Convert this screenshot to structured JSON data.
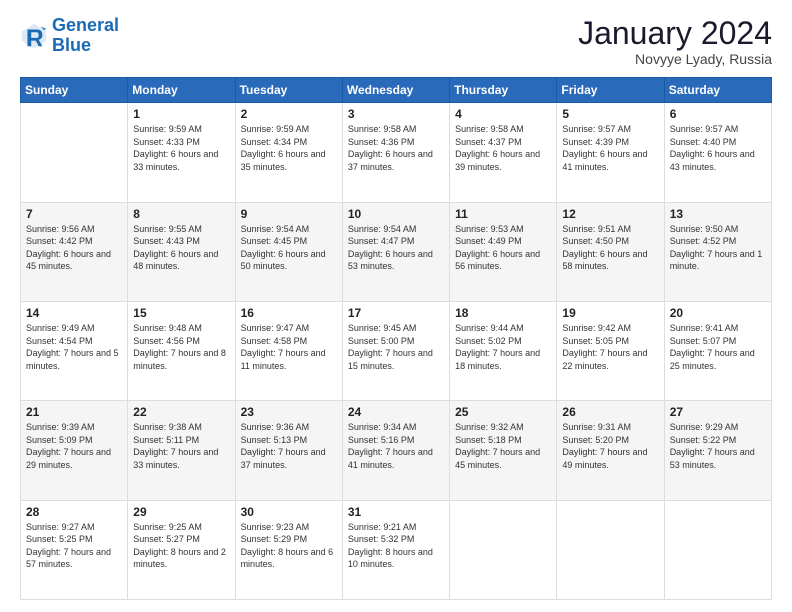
{
  "logo": {
    "line1": "General",
    "line2": "Blue"
  },
  "title": "January 2024",
  "subtitle": "Novyye Lyady, Russia",
  "weekdays": [
    "Sunday",
    "Monday",
    "Tuesday",
    "Wednesday",
    "Thursday",
    "Friday",
    "Saturday"
  ],
  "weeks": [
    [
      {
        "day": "",
        "sunrise": "",
        "sunset": "",
        "daylight": ""
      },
      {
        "day": "1",
        "sunrise": "Sunrise: 9:59 AM",
        "sunset": "Sunset: 4:33 PM",
        "daylight": "Daylight: 6 hours and 33 minutes."
      },
      {
        "day": "2",
        "sunrise": "Sunrise: 9:59 AM",
        "sunset": "Sunset: 4:34 PM",
        "daylight": "Daylight: 6 hours and 35 minutes."
      },
      {
        "day": "3",
        "sunrise": "Sunrise: 9:58 AM",
        "sunset": "Sunset: 4:36 PM",
        "daylight": "Daylight: 6 hours and 37 minutes."
      },
      {
        "day": "4",
        "sunrise": "Sunrise: 9:58 AM",
        "sunset": "Sunset: 4:37 PM",
        "daylight": "Daylight: 6 hours and 39 minutes."
      },
      {
        "day": "5",
        "sunrise": "Sunrise: 9:57 AM",
        "sunset": "Sunset: 4:39 PM",
        "daylight": "Daylight: 6 hours and 41 minutes."
      },
      {
        "day": "6",
        "sunrise": "Sunrise: 9:57 AM",
        "sunset": "Sunset: 4:40 PM",
        "daylight": "Daylight: 6 hours and 43 minutes."
      }
    ],
    [
      {
        "day": "7",
        "sunrise": "Sunrise: 9:56 AM",
        "sunset": "Sunset: 4:42 PM",
        "daylight": "Daylight: 6 hours and 45 minutes."
      },
      {
        "day": "8",
        "sunrise": "Sunrise: 9:55 AM",
        "sunset": "Sunset: 4:43 PM",
        "daylight": "Daylight: 6 hours and 48 minutes."
      },
      {
        "day": "9",
        "sunrise": "Sunrise: 9:54 AM",
        "sunset": "Sunset: 4:45 PM",
        "daylight": "Daylight: 6 hours and 50 minutes."
      },
      {
        "day": "10",
        "sunrise": "Sunrise: 9:54 AM",
        "sunset": "Sunset: 4:47 PM",
        "daylight": "Daylight: 6 hours and 53 minutes."
      },
      {
        "day": "11",
        "sunrise": "Sunrise: 9:53 AM",
        "sunset": "Sunset: 4:49 PM",
        "daylight": "Daylight: 6 hours and 56 minutes."
      },
      {
        "day": "12",
        "sunrise": "Sunrise: 9:51 AM",
        "sunset": "Sunset: 4:50 PM",
        "daylight": "Daylight: 6 hours and 58 minutes."
      },
      {
        "day": "13",
        "sunrise": "Sunrise: 9:50 AM",
        "sunset": "Sunset: 4:52 PM",
        "daylight": "Daylight: 7 hours and 1 minute."
      }
    ],
    [
      {
        "day": "14",
        "sunrise": "Sunrise: 9:49 AM",
        "sunset": "Sunset: 4:54 PM",
        "daylight": "Daylight: 7 hours and 5 minutes."
      },
      {
        "day": "15",
        "sunrise": "Sunrise: 9:48 AM",
        "sunset": "Sunset: 4:56 PM",
        "daylight": "Daylight: 7 hours and 8 minutes."
      },
      {
        "day": "16",
        "sunrise": "Sunrise: 9:47 AM",
        "sunset": "Sunset: 4:58 PM",
        "daylight": "Daylight: 7 hours and 11 minutes."
      },
      {
        "day": "17",
        "sunrise": "Sunrise: 9:45 AM",
        "sunset": "Sunset: 5:00 PM",
        "daylight": "Daylight: 7 hours and 15 minutes."
      },
      {
        "day": "18",
        "sunrise": "Sunrise: 9:44 AM",
        "sunset": "Sunset: 5:02 PM",
        "daylight": "Daylight: 7 hours and 18 minutes."
      },
      {
        "day": "19",
        "sunrise": "Sunrise: 9:42 AM",
        "sunset": "Sunset: 5:05 PM",
        "daylight": "Daylight: 7 hours and 22 minutes."
      },
      {
        "day": "20",
        "sunrise": "Sunrise: 9:41 AM",
        "sunset": "Sunset: 5:07 PM",
        "daylight": "Daylight: 7 hours and 25 minutes."
      }
    ],
    [
      {
        "day": "21",
        "sunrise": "Sunrise: 9:39 AM",
        "sunset": "Sunset: 5:09 PM",
        "daylight": "Daylight: 7 hours and 29 minutes."
      },
      {
        "day": "22",
        "sunrise": "Sunrise: 9:38 AM",
        "sunset": "Sunset: 5:11 PM",
        "daylight": "Daylight: 7 hours and 33 minutes."
      },
      {
        "day": "23",
        "sunrise": "Sunrise: 9:36 AM",
        "sunset": "Sunset: 5:13 PM",
        "daylight": "Daylight: 7 hours and 37 minutes."
      },
      {
        "day": "24",
        "sunrise": "Sunrise: 9:34 AM",
        "sunset": "Sunset: 5:16 PM",
        "daylight": "Daylight: 7 hours and 41 minutes."
      },
      {
        "day": "25",
        "sunrise": "Sunrise: 9:32 AM",
        "sunset": "Sunset: 5:18 PM",
        "daylight": "Daylight: 7 hours and 45 minutes."
      },
      {
        "day": "26",
        "sunrise": "Sunrise: 9:31 AM",
        "sunset": "Sunset: 5:20 PM",
        "daylight": "Daylight: 7 hours and 49 minutes."
      },
      {
        "day": "27",
        "sunrise": "Sunrise: 9:29 AM",
        "sunset": "Sunset: 5:22 PM",
        "daylight": "Daylight: 7 hours and 53 minutes."
      }
    ],
    [
      {
        "day": "28",
        "sunrise": "Sunrise: 9:27 AM",
        "sunset": "Sunset: 5:25 PM",
        "daylight": "Daylight: 7 hours and 57 minutes."
      },
      {
        "day": "29",
        "sunrise": "Sunrise: 9:25 AM",
        "sunset": "Sunset: 5:27 PM",
        "daylight": "Daylight: 8 hours and 2 minutes."
      },
      {
        "day": "30",
        "sunrise": "Sunrise: 9:23 AM",
        "sunset": "Sunset: 5:29 PM",
        "daylight": "Daylight: 8 hours and 6 minutes."
      },
      {
        "day": "31",
        "sunrise": "Sunrise: 9:21 AM",
        "sunset": "Sunset: 5:32 PM",
        "daylight": "Daylight: 8 hours and 10 minutes."
      },
      {
        "day": "",
        "sunrise": "",
        "sunset": "",
        "daylight": ""
      },
      {
        "day": "",
        "sunrise": "",
        "sunset": "",
        "daylight": ""
      },
      {
        "day": "",
        "sunrise": "",
        "sunset": "",
        "daylight": ""
      }
    ]
  ]
}
